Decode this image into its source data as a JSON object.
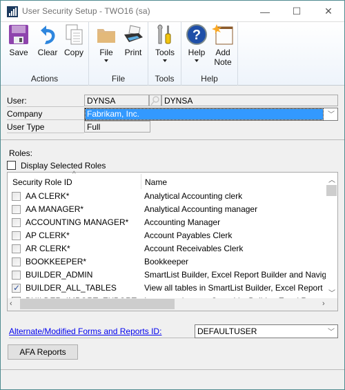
{
  "window": {
    "title": "User Security Setup  -  TWO16 (sa)",
    "controls": {
      "minimize": "—",
      "maximize": "☐",
      "close": "✕"
    }
  },
  "ribbon": {
    "groups": [
      {
        "label": "Actions",
        "buttons": [
          {
            "label": "Save",
            "icon": "save-icon"
          },
          {
            "label": "Clear",
            "icon": "undo-icon"
          },
          {
            "label": "Copy",
            "icon": "copy-icon"
          }
        ]
      },
      {
        "label": "File",
        "buttons": [
          {
            "label": "File",
            "icon": "folder-icon",
            "dropdown": true
          },
          {
            "label": "Print",
            "icon": "printer-icon"
          }
        ]
      },
      {
        "label": "Tools",
        "buttons": [
          {
            "label": "Tools",
            "icon": "tools-icon",
            "dropdown": true
          }
        ]
      },
      {
        "label": "Help",
        "buttons": [
          {
            "label": "Help",
            "icon": "help-icon",
            "dropdown": true
          },
          {
            "label": "Add",
            "label2": "Note",
            "icon": "add-note-icon"
          }
        ]
      }
    ]
  },
  "form": {
    "user_label": "User:",
    "user_id": "DYNSA",
    "user_name": "DYNSA",
    "company_label": "Company",
    "company_value": "Fabrikam, Inc.",
    "user_type_label": "User Type",
    "user_type_value": "Full",
    "roles_label": "Roles:",
    "display_selected_label": "Display Selected Roles",
    "display_selected_checked": false
  },
  "roles_table": {
    "columns": [
      "Security Role ID",
      "Name"
    ],
    "sort_indicator": "^",
    "rows": [
      {
        "id": "AA CLERK*",
        "name": "Analytical Accounting clerk",
        "checked": false
      },
      {
        "id": "AA MANAGER*",
        "name": "Analytical Accounting manager",
        "checked": false
      },
      {
        "id": "ACCOUNTING MANAGER*",
        "name": "Accounting Manager",
        "checked": false
      },
      {
        "id": "AP CLERK*",
        "name": "Account Payables Clerk",
        "checked": false
      },
      {
        "id": "AR CLERK*",
        "name": "Account Receivables Clerk",
        "checked": false
      },
      {
        "id": "BOOKKEEPER*",
        "name": "Bookkeeper",
        "checked": false
      },
      {
        "id": "BUILDER_ADMIN",
        "name": "SmartList Builder, Excel Report Builder and Naviga",
        "checked": false
      },
      {
        "id": "BUILDER_ALL_TABLES",
        "name": "View all tables in SmartList Builder, Excel Report",
        "checked": true
      },
      {
        "id": "BUILDER_IMPORT_EXPORT",
        "name": "Import and export SmartList Builder, Excel Report",
        "checked": false
      }
    ]
  },
  "alt_forms": {
    "link_label": "Alternate/Modified Forms and Reports ID:",
    "value": "DEFAULTUSER"
  },
  "afa_button": "AFA Reports",
  "colors": {
    "selection": "#3399ff",
    "link": "#0000ee",
    "window_border": "#4f8a8f"
  }
}
